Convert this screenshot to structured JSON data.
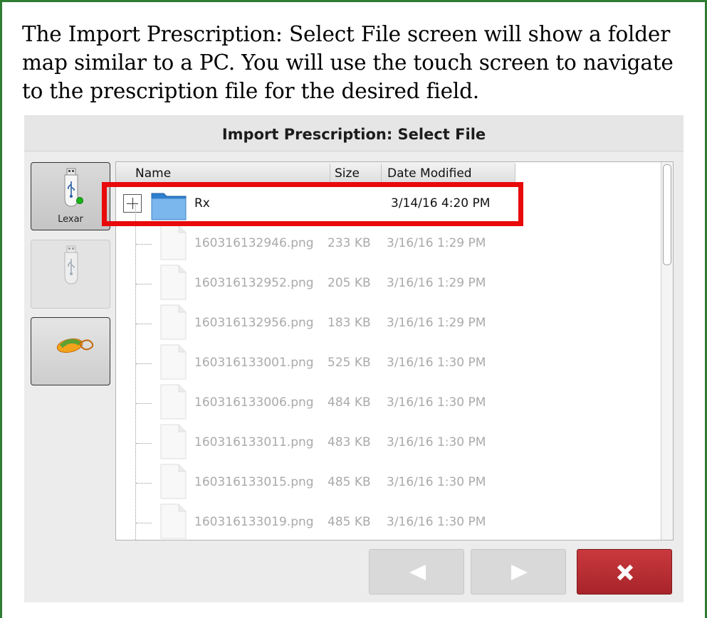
{
  "caption": "The Import Prescription: Select File screen will show a folder map similar to a PC.  You will use the touch screen to navigate to the prescription file for the desired field.",
  "screen_title": "Import Prescription: Select File",
  "devices": [
    {
      "label": "Lexar",
      "icon": "usb-drive-icon",
      "state": "selected-connected"
    },
    {
      "label": "",
      "icon": "usb-drive-icon",
      "state": "disabled"
    },
    {
      "label": "",
      "icon": "display-app-icon",
      "state": "enabled"
    }
  ],
  "columns": {
    "name": "Name",
    "size": "Size",
    "date": "Date Modified"
  },
  "folder": {
    "name": "Rx",
    "size": "",
    "date": "3/14/16 4:20 PM",
    "highlighted": true
  },
  "files": [
    {
      "name": "160316132946.png",
      "size": "233 KB",
      "date": "3/16/16 1:29 PM"
    },
    {
      "name": "160316132952.png",
      "size": "205 KB",
      "date": "3/16/16 1:29 PM"
    },
    {
      "name": "160316132956.png",
      "size": "183 KB",
      "date": "3/16/16 1:29 PM"
    },
    {
      "name": "160316133001.png",
      "size": "525 KB",
      "date": "3/16/16 1:30 PM"
    },
    {
      "name": "160316133006.png",
      "size": "484 KB",
      "date": "3/16/16 1:30 PM"
    },
    {
      "name": "160316133011.png",
      "size": "483 KB",
      "date": "3/16/16 1:30 PM"
    },
    {
      "name": "160316133015.png",
      "size": "485 KB",
      "date": "3/16/16 1:30 PM"
    },
    {
      "name": "160316133019.png",
      "size": "485 KB",
      "date": "3/16/16 1:30 PM"
    }
  ],
  "buttons": {
    "prev": "previous-arrow-icon",
    "next": "next-arrow-icon",
    "cancel": "close-x-icon"
  },
  "colors": {
    "frame": "#2f7d32",
    "highlight": "#e8090b",
    "cancel": "#b52d32"
  }
}
